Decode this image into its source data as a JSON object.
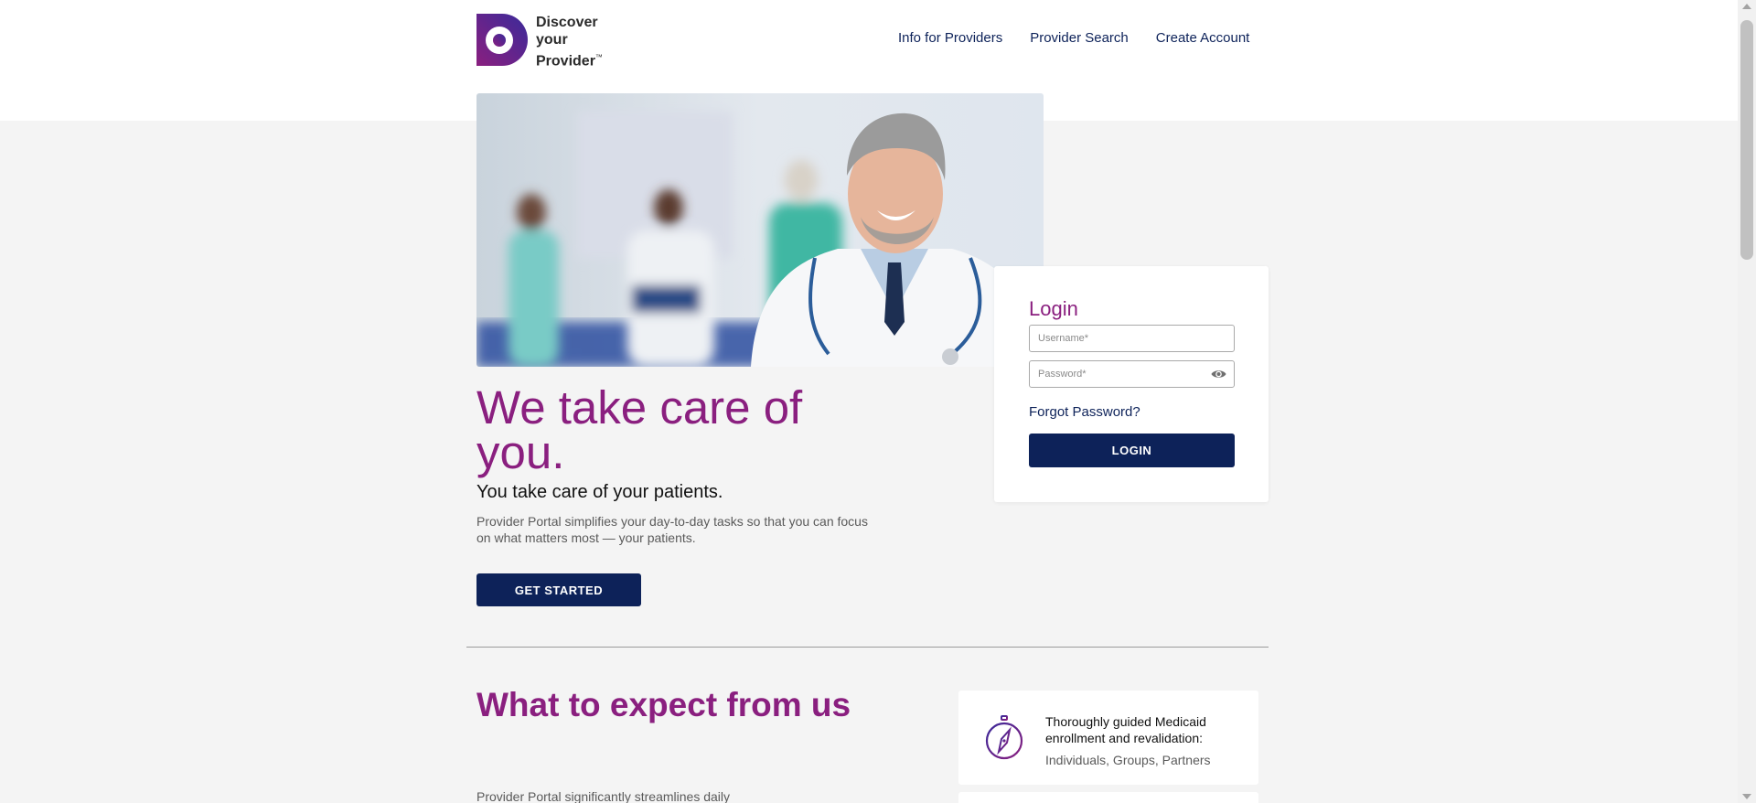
{
  "brand": {
    "line1": "Discover",
    "line2": "your",
    "line3": "Provider",
    "tm": "™",
    "colors": {
      "purple": "#8a1f7f",
      "navy": "#0d2259",
      "gradient_start": "#3a2a9a",
      "gradient_end": "#8a1f7f"
    }
  },
  "nav": {
    "items": [
      {
        "label": "Info for Providers"
      },
      {
        "label": "Provider Search"
      },
      {
        "label": "Create Account"
      }
    ]
  },
  "hero": {
    "image_icon": "doctor-photo"
  },
  "login": {
    "title": "Login",
    "username_placeholder": "Username*",
    "username_value": "",
    "password_placeholder": "Password*",
    "password_value": "",
    "password_toggle_icon": "eye-icon",
    "forgot_label": "Forgot Password?",
    "button_label": "LOGIN"
  },
  "intro": {
    "headline": "We take care of you.",
    "subhead": "You take care of your patients.",
    "description": "Provider Portal simplifies your day-to-day tasks so that you can focus on what matters most — your patients.",
    "cta_label": "GET STARTED"
  },
  "expect": {
    "title": "What to expect from us",
    "description": "Provider Portal significantly streamlines daily",
    "features": [
      {
        "icon": "compass-icon",
        "title": "Thoroughly guided Medicaid enrollment and revalidation:",
        "subtitle": "Individuals, Groups, Partners"
      }
    ]
  }
}
